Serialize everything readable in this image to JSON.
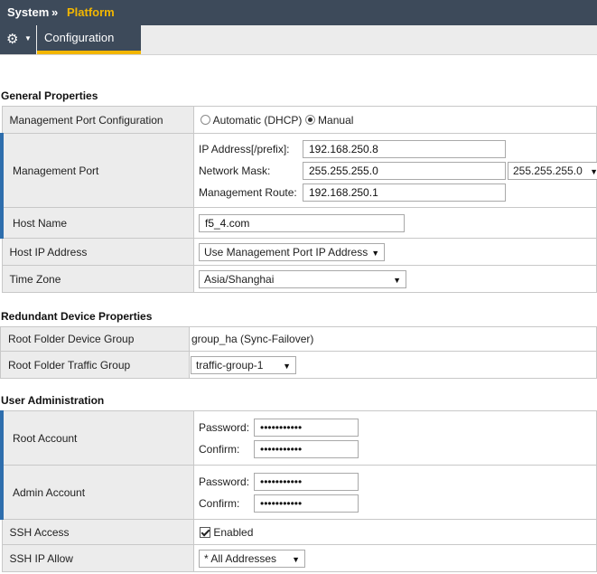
{
  "breadcrumb": {
    "system": "System",
    "separator": "»",
    "platform": "Platform"
  },
  "toolbar": {
    "tab_label": "Configuration"
  },
  "general": {
    "title": "General Properties",
    "mgmt_config_label": "Management Port Configuration",
    "option_dhcp": "Automatic (DHCP)",
    "option_manual": "Manual",
    "mgmt_port_label": "Management Port",
    "ip_label": "IP Address[/prefix]:",
    "ip_value": "192.168.250.8",
    "mask_label": "Network Mask:",
    "mask_value": "255.255.255.0",
    "mask_select": "255.255.255.0",
    "route_label": "Management Route:",
    "route_value": "192.168.250.1",
    "hostname_label": "Host Name",
    "hostname_value": "f5_4.com",
    "hostip_label": "Host IP Address",
    "hostip_value": "Use Management Port IP Address",
    "timezone_label": "Time Zone",
    "timezone_value": "Asia/Shanghai"
  },
  "redundant": {
    "title": "Redundant Device Properties",
    "device_group_label": "Root Folder Device Group",
    "device_group_value": "group_ha (Sync-Failover)",
    "traffic_group_label": "Root Folder Traffic Group",
    "traffic_group_value": "traffic-group-1"
  },
  "users": {
    "title": "User Administration",
    "root_label": "Root Account",
    "admin_label": "Admin Account",
    "password_label": "Password:",
    "confirm_label": "Confirm:",
    "masked": "•••••••••••",
    "ssh_label": "SSH Access",
    "ssh_enabled": "Enabled",
    "ssh_allow_label": "SSH IP Allow",
    "ssh_allow_value": "* All Addresses"
  },
  "icons": {
    "gear": "gear-icon",
    "caret": "chevron-down-icon",
    "dropdown": "chevron-down-icon"
  },
  "colors": {
    "header_bg": "#3d4a5a",
    "accent": "#f2b600",
    "required_bar": "#2e6ead",
    "label_bg": "#ececec"
  }
}
